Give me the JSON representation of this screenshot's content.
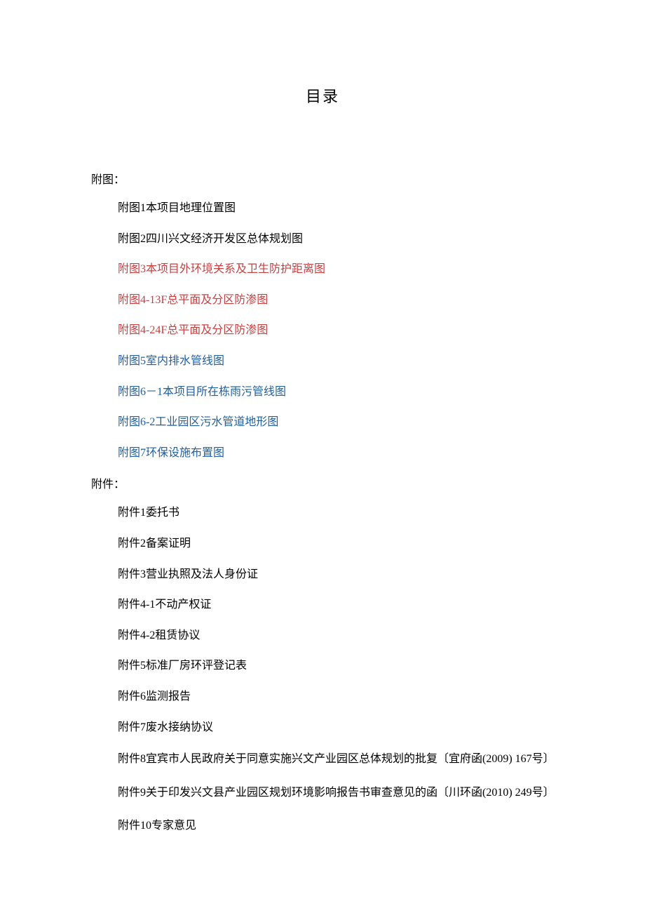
{
  "title": "目录",
  "sections": {
    "futu": {
      "label": "附图：",
      "items": [
        {
          "text": "附图1本项目地理位置图",
          "color": "black"
        },
        {
          "text": "附图2四川兴文经济开发区总体规划图",
          "color": "black"
        },
        {
          "text": "附图3本项目外环境关系及卫生防护距离图",
          "color": "red"
        },
        {
          "text": "附图4-13F总平面及分区防渗图",
          "color": "red"
        },
        {
          "text": "附图4-24F总平面及分区防渗图",
          "color": "red"
        },
        {
          "text": "附图5室内排水管线图",
          "color": "blue"
        },
        {
          "text": "附图6－1本项目所在栋雨污管线图",
          "color": "blue"
        },
        {
          "text": "附图6-2工业园区污水管道地形图",
          "color": "blue"
        },
        {
          "text": "附图7环保设施布置图",
          "color": "blue"
        }
      ]
    },
    "fujian": {
      "label": "附件：",
      "items": [
        {
          "text": "附件1委托书",
          "color": "black"
        },
        {
          "text": "附件2备案证明",
          "color": "black"
        },
        {
          "text": "附件3营业执照及法人身份证",
          "color": "black"
        },
        {
          "text": "附件4-1不动产权证",
          "color": "black"
        },
        {
          "text": "附件4-2租赁协议",
          "color": "black"
        },
        {
          "text": "附件5标准厂房环评登记表",
          "color": "black"
        },
        {
          "text": "附件6监测报告",
          "color": "black"
        },
        {
          "text": "附件7废水接纳协议",
          "color": "black"
        },
        {
          "text": "附件8宜宾市人民政府关于同意实施兴文产业园区总体规划的批复〔宜府函(2009) 167号〕",
          "color": "black",
          "wrap": true
        },
        {
          "text": "附件9关于印发兴文县产业园区规划环境影响报告书审查意见的函〔川环函(2010) 249号〕",
          "color": "black",
          "wrap": true
        },
        {
          "text": "附件10专家意见",
          "color": "black"
        }
      ]
    }
  }
}
